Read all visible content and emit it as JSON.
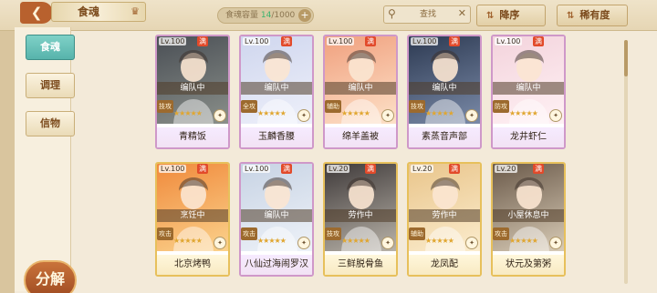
{
  "header": {
    "title": "食魂",
    "capacity_label": "食魂容量",
    "capacity_current": "14",
    "capacity_total": "/1000",
    "search_placeholder": "查找",
    "sort_order_label": "降序",
    "sort_rarity_label": "稀有度"
  },
  "sidebar": {
    "tabs": [
      {
        "label": "食魂",
        "active": true
      },
      {
        "label": "调理",
        "active": false
      },
      {
        "label": "信物",
        "active": false
      }
    ],
    "decompose_label": "分解"
  },
  "cards": [
    {
      "level": "Lv.100",
      "full": "满",
      "status": "编队中",
      "type": "技攻",
      "stars": "★★★★★",
      "name": "青精饭",
      "frame": "pink"
    },
    {
      "level": "Lv.100",
      "full": "满",
      "status": "编队中",
      "type": "全攻",
      "stars": "★★★★★",
      "name": "玉麟香腰",
      "frame": "pink"
    },
    {
      "level": "Lv.100",
      "full": "满",
      "status": "编队中",
      "type": "辅助",
      "stars": "★★★★★",
      "name": "绵羊盖被",
      "frame": "pink"
    },
    {
      "level": "Lv.100",
      "full": "满",
      "status": "编队中",
      "type": "技攻",
      "stars": "★★★★★",
      "name": "素蒸音声部",
      "frame": "pink"
    },
    {
      "level": "Lv.100",
      "full": "满",
      "status": "编队中",
      "type": "防攻",
      "stars": "★★★★★",
      "name": "龙井虾仁",
      "frame": "pink"
    },
    {
      "level": "Lv.100",
      "full": "满",
      "status": "烹饪中",
      "type": "攻击",
      "stars": "★★★★★",
      "name": "北京烤鸭",
      "frame": "gold"
    },
    {
      "level": "Lv.100",
      "full": "满",
      "status": "编队中",
      "type": "攻击",
      "stars": "★★★★★",
      "name": "八仙过海闹罗汉",
      "frame": "pink"
    },
    {
      "level": "Lv.20",
      "full": "满",
      "status": "劳作中",
      "type": "技攻",
      "stars": "★★★★★",
      "name": "三鲜脱骨鱼",
      "frame": "gold"
    },
    {
      "level": "Lv.20",
      "full": "满",
      "status": "劳作中",
      "type": "辅助",
      "stars": "★★★★★",
      "name": "龙凤配",
      "frame": "gold"
    },
    {
      "level": "Lv.20",
      "full": "满",
      "status": "小屋休息中",
      "type": "攻击",
      "stars": "★★★★★",
      "name": "状元及第粥",
      "frame": "gold"
    }
  ],
  "colors": {
    "accent": "#57b3ab",
    "frame_pink": "#cf98c9",
    "frame_gold": "#e7c05b",
    "button_brown": "#9e4a21"
  }
}
